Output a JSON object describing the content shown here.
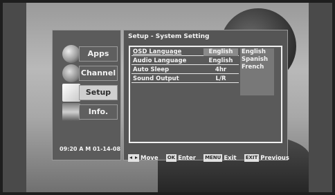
{
  "sidebar": {
    "items": [
      {
        "label": "Apps",
        "icon": "globe-icon"
      },
      {
        "label": "Channel",
        "icon": "channel-icon"
      },
      {
        "label": "Setup",
        "icon": "setup-icon"
      },
      {
        "label": "Info.",
        "icon": "info-icon"
      }
    ],
    "active": "Setup",
    "clock": "09:20 A M 01-14-08"
  },
  "main": {
    "title": "Setup - System Setting",
    "rows": [
      {
        "label": "OSD Language",
        "value": "English"
      },
      {
        "label": "Audio Language",
        "value": "English"
      },
      {
        "label": "Auto Sleep",
        "value": "4hr"
      },
      {
        "label": "Sound Output",
        "value": "L/R"
      }
    ],
    "dropdown_options": [
      "English",
      "Spanish",
      "French"
    ]
  },
  "footer": {
    "move": "Move",
    "ok_key": "OK",
    "enter": "Enter",
    "menu_key": "MENU",
    "exit": "Exit",
    "exit_key": "EXIT",
    "previous": "Previous"
  },
  "colors": {
    "panel_bg": "#555555",
    "selection": "#8b8b8b",
    "text": "#f4f4f4"
  }
}
